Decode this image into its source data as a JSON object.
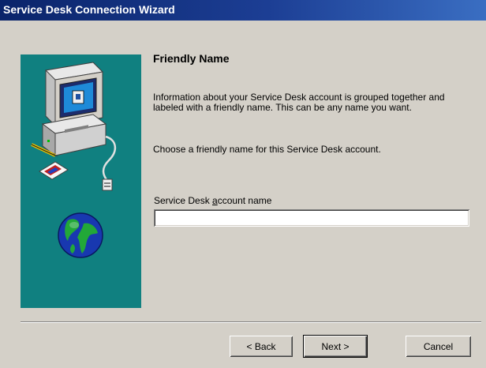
{
  "window": {
    "title": "Service Desk Connection Wizard"
  },
  "page": {
    "heading": "Friendly Name",
    "description": "Information about your Service Desk account is grouped together and labeled with a friendly name. This can be any name you want.",
    "instruction": "Choose a friendly name for this Service Desk account.",
    "field": {
      "label_before": "Service Desk ",
      "label_accel": "a",
      "label_after": "ccount name",
      "value": "",
      "placeholder": ""
    }
  },
  "buttons": {
    "back": "< Back",
    "next": "Next >",
    "cancel": "Cancel"
  },
  "colors": {
    "side_panel": "#108080",
    "titlebar": "#0a246a",
    "dialog_face": "#d4d0c8"
  },
  "icons": {
    "side_panel": [
      "computer-icon",
      "pencil-icon",
      "envelope-icon",
      "network-plug-icon",
      "globe-icon"
    ]
  }
}
